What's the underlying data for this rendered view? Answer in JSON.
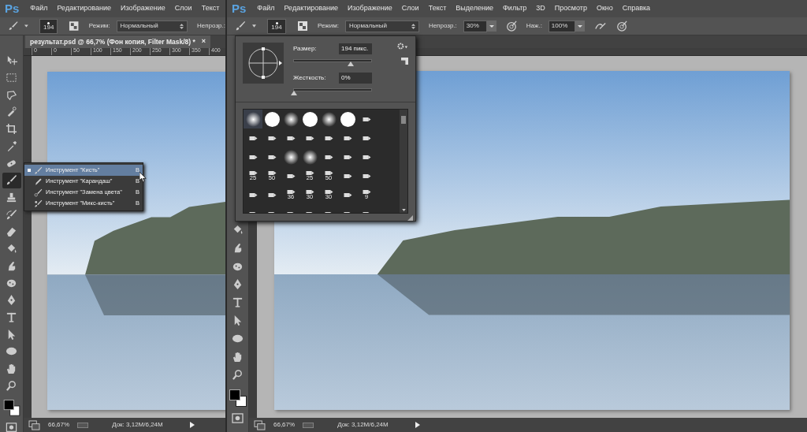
{
  "left_window": {
    "logo": "Ps",
    "menu": [
      "Файл",
      "Редактирование",
      "Изображение",
      "Слои",
      "Текст"
    ],
    "options": {
      "brush_size": "194",
      "mode_label": "Режим:",
      "mode_value": "Нормальный",
      "opacity_label": "Непрозр.:"
    },
    "document_tab": {
      "title": "результат.psd @ 66,7% (Фон копия, Filter Mask/8) *",
      "close": "×"
    },
    "ruler": [
      "0",
      "0",
      "50",
      "100",
      "150",
      "200",
      "250",
      "300",
      "350",
      "400"
    ],
    "tools": [
      {
        "kind": "move",
        "selected": false
      },
      {
        "kind": "marquee",
        "selected": false
      },
      {
        "kind": "lasso",
        "selected": false
      },
      {
        "kind": "quick_select",
        "selected": false
      },
      {
        "kind": "crop",
        "selected": false
      },
      {
        "kind": "eyedropper",
        "selected": false
      },
      {
        "kind": "healing",
        "selected": false
      },
      {
        "kind": "brush",
        "selected": true
      },
      {
        "kind": "stamp",
        "selected": false
      },
      {
        "kind": "history",
        "selected": false
      },
      {
        "kind": "eraser",
        "selected": false
      },
      {
        "kind": "bucket",
        "selected": false
      },
      {
        "kind": "blur",
        "selected": false
      },
      {
        "kind": "dodge",
        "selected": false
      },
      {
        "kind": "pen",
        "selected": false
      },
      {
        "kind": "type",
        "selected": false
      },
      {
        "kind": "path_select",
        "selected": false
      },
      {
        "kind": "ellipse",
        "selected": false
      },
      {
        "kind": "hand",
        "selected": false
      },
      {
        "kind": "zoom",
        "selected": false
      }
    ],
    "flyout": [
      {
        "kind": "brush",
        "label": "Инструмент \"Кисть\"",
        "shortcut": "B",
        "selected": true
      },
      {
        "kind": "pencil",
        "label": "Инструмент \"Карандаш\"",
        "shortcut": "B",
        "selected": false
      },
      {
        "kind": "replace",
        "label": "Инструмент \"Замена цвета\"",
        "shortcut": "B",
        "selected": false
      },
      {
        "kind": "mixer",
        "label": "Инструмент \"Микс-кисть\"",
        "shortcut": "B",
        "selected": false
      }
    ],
    "status": {
      "zoom": "66,67%",
      "doc": "Док: 3,12M/6,24M"
    }
  },
  "right_window": {
    "logo": "Ps",
    "menu": [
      "Файл",
      "Редактирование",
      "Изображение",
      "Слои",
      "Текст",
      "Выделение",
      "Фильтр",
      "3D",
      "Просмотр",
      "Окно",
      "Справка"
    ],
    "options": {
      "brush_size": "194",
      "mode_label": "Режим:",
      "mode_value": "Нормальный",
      "opacity_label": "Непрозр.:",
      "opacity_value": "30%",
      "flow_label": "Наж.:",
      "flow_value": "100%"
    },
    "tools": [
      {
        "kind": "bucket",
        "selected": false
      },
      {
        "kind": "blur",
        "selected": false
      },
      {
        "kind": "dodge",
        "selected": false
      },
      {
        "kind": "pen",
        "selected": false
      },
      {
        "kind": "type",
        "selected": false
      },
      {
        "kind": "path_select",
        "selected": false
      },
      {
        "kind": "ellipse",
        "selected": false
      },
      {
        "kind": "hand",
        "selected": false
      },
      {
        "kind": "zoom",
        "selected": false
      }
    ],
    "brush_panel": {
      "size": {
        "label": "Размер:",
        "value": "194 пикс.",
        "level": 0.73
      },
      "hardness": {
        "label": "Жесткость:",
        "value": "0%",
        "level": 0
      },
      "presets": [
        {
          "kind": "soft",
          "selected": true
        },
        {
          "kind": "hard",
          "selected": false
        },
        {
          "kind": "soft",
          "selected": false
        },
        {
          "kind": "hard",
          "selected": false
        },
        {
          "kind": "soft",
          "selected": false
        },
        {
          "kind": "hard",
          "selected": false
        },
        {
          "kind": "tip",
          "selected": false
        },
        {
          "kind": "tip",
          "selected": false
        },
        {
          "kind": "tip",
          "selected": false
        },
        {
          "kind": "tip",
          "selected": false
        },
        {
          "kind": "tip",
          "selected": false
        },
        {
          "kind": "tip",
          "selected": false
        },
        {
          "kind": "tip",
          "selected": false
        },
        {
          "kind": "tip",
          "selected": false
        },
        {
          "kind": "tip",
          "selected": false
        },
        {
          "kind": "tip",
          "selected": false
        },
        {
          "kind": "soft",
          "selected": false
        },
        {
          "kind": "soft",
          "selected": false
        },
        {
          "kind": "tip",
          "selected": false
        },
        {
          "kind": "tip",
          "selected": false
        },
        {
          "kind": "tip",
          "selected": false
        },
        {
          "kind": "tip",
          "label": "25",
          "selected": false
        },
        {
          "kind": "tip",
          "label": "50",
          "selected": false
        },
        {
          "kind": "tip",
          "selected": false
        },
        {
          "kind": "tip",
          "label": "25",
          "selected": false
        },
        {
          "kind": "tip",
          "label": "50",
          "selected": false
        },
        {
          "kind": "tip",
          "selected": false
        },
        {
          "kind": "tip",
          "selected": false
        },
        {
          "kind": "tip",
          "selected": false
        },
        {
          "kind": "tip",
          "selected": false
        },
        {
          "kind": "tip",
          "label": "36",
          "selected": false
        },
        {
          "kind": "tip",
          "label": "30",
          "selected": false
        },
        {
          "kind": "tip",
          "label": "30",
          "selected": false
        },
        {
          "kind": "tip",
          "selected": false
        },
        {
          "kind": "tip",
          "label": "9",
          "selected": false
        },
        {
          "kind": "tip",
          "selected": false
        },
        {
          "kind": "tip",
          "selected": false
        },
        {
          "kind": "tip",
          "selected": false
        },
        {
          "kind": "tip",
          "selected": false
        },
        {
          "kind": "tip",
          "selected": false
        },
        {
          "kind": "tip",
          "selected": false
        },
        {
          "kind": "tip",
          "selected": false
        }
      ]
    },
    "status": {
      "zoom": "66,67%",
      "doc": "Док: 3,12M/6,24M"
    }
  }
}
